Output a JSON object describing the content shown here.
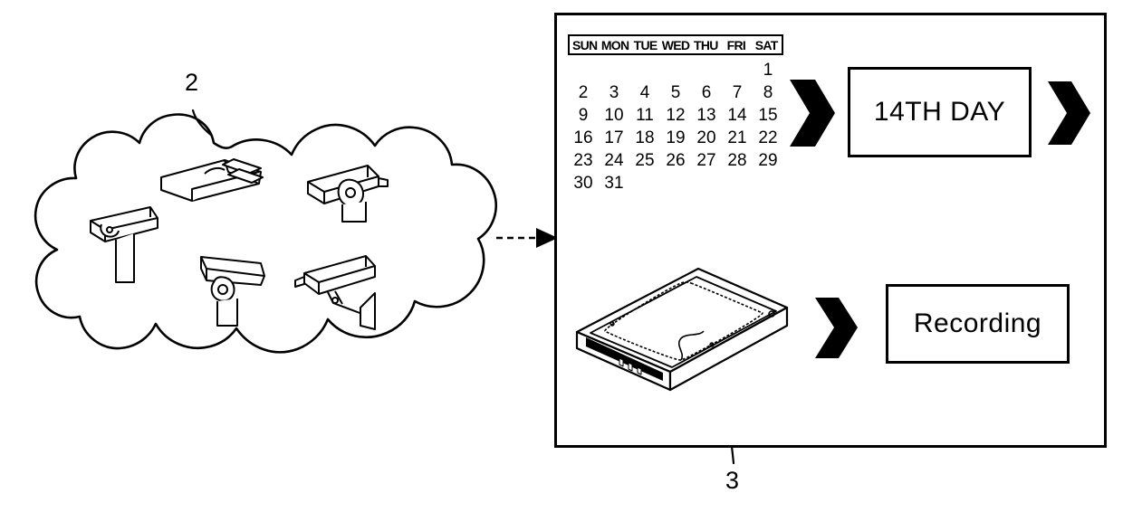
{
  "figure": {
    "type": "patent-diagram",
    "background_color": "#ffffff",
    "line_color": "#000000"
  },
  "reference_numerals": {
    "cloud": "2",
    "hdd": "3"
  },
  "cloud": {
    "name": "camera-cloud",
    "camera_count": 5,
    "cameras": [
      {
        "id": "camera-top",
        "label": "surveillance-camera"
      },
      {
        "id": "camera-upper-right",
        "label": "surveillance-camera"
      },
      {
        "id": "camera-left",
        "label": "surveillance-camera"
      },
      {
        "id": "camera-center",
        "label": "surveillance-camera"
      },
      {
        "id": "camera-right",
        "label": "surveillance-camera"
      }
    ]
  },
  "flow_arrow": {
    "name": "cloud-to-system-arrow",
    "style": "dashed"
  },
  "system_box": {
    "name": "recording-system-box"
  },
  "calendar": {
    "day_headers": [
      "SUN",
      "MON",
      "TUE",
      "WED",
      "THU",
      "FRI",
      "SAT"
    ],
    "weeks": [
      [
        "",
        "",
        "",
        "",
        "",
        "",
        "1"
      ],
      [
        "2",
        "3",
        "4",
        "5",
        "6",
        "7",
        "8"
      ],
      [
        "9",
        "10",
        "11",
        "12",
        "13",
        "14",
        "15"
      ],
      [
        "16",
        "17",
        "18",
        "19",
        "20",
        "21",
        "22"
      ],
      [
        "23",
        "24",
        "25",
        "26",
        "27",
        "28",
        "29"
      ],
      [
        "30",
        "31",
        "",
        "",
        "",
        "",
        ""
      ]
    ]
  },
  "boxes": {
    "day_label": "14TH DAY",
    "recording_label": "Recording"
  },
  "chevrons": {
    "calendar_to_day": "chevron-right-icon",
    "day_to_output": "chevron-right-icon",
    "hdd_to_recording": "chevron-right-icon"
  },
  "hdd": {
    "name": "hard-disk-drive",
    "label": "hard-disk-drive-illustration"
  }
}
